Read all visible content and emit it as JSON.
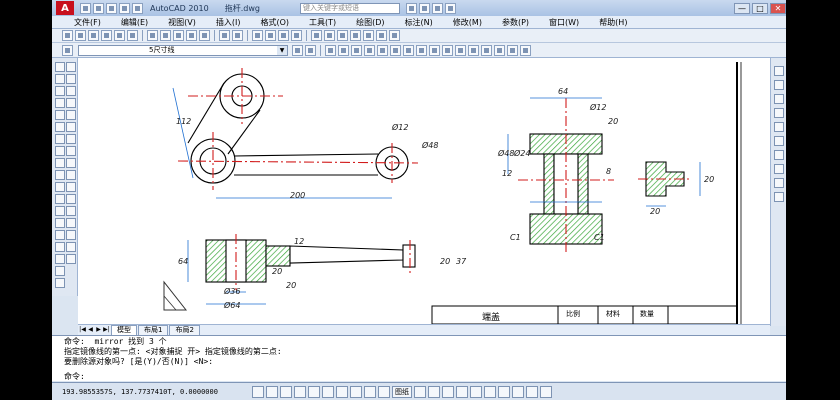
{
  "titlebar": {
    "app_title": "AutoCAD 2010",
    "file_name": "拖杆.dwg",
    "search_placeholder": "键入关键字或短语",
    "minimize": "—",
    "maximize": "□",
    "close": "✕"
  },
  "menu": [
    "文件(F)",
    "编辑(E)",
    "视图(V)",
    "插入(I)",
    "格式(O)",
    "工具(T)",
    "绘图(D)",
    "标注(N)",
    "修改(M)",
    "参数(P)",
    "窗口(W)",
    "帮助(H)"
  ],
  "layer": {
    "current": "5尺寸线"
  },
  "drawing": {
    "dimensions": [
      "64",
      "Ø12",
      "20",
      "Ø12",
      "Ø48",
      "Ø48",
      "Ø24",
      "12",
      "8",
      "20",
      "20",
      "C1",
      "C1",
      "112",
      "200",
      "64",
      "12",
      "20",
      "20",
      "37",
      "Ø36",
      "Ø64",
      "20"
    ],
    "title_block": {
      "name": "端盖",
      "scale": "比例",
      "material": "材料",
      "quantity": "数量"
    }
  },
  "tabs": {
    "model": "模型",
    "layout1": "布局1",
    "layout2": "布局2"
  },
  "command": {
    "lines": [
      "命令:  mirror 找到 3 个",
      "指定镜像线的第一点: <对象捕捉 开> 指定镜像线的第二点:",
      "要删除源对象吗? [是(Y)/否(N)] <N>:"
    ],
    "prompt": "命令:"
  },
  "status": {
    "coordinates": "193.9855357S, 137.7737410T, 0.0000000",
    "paper": "图纸"
  }
}
